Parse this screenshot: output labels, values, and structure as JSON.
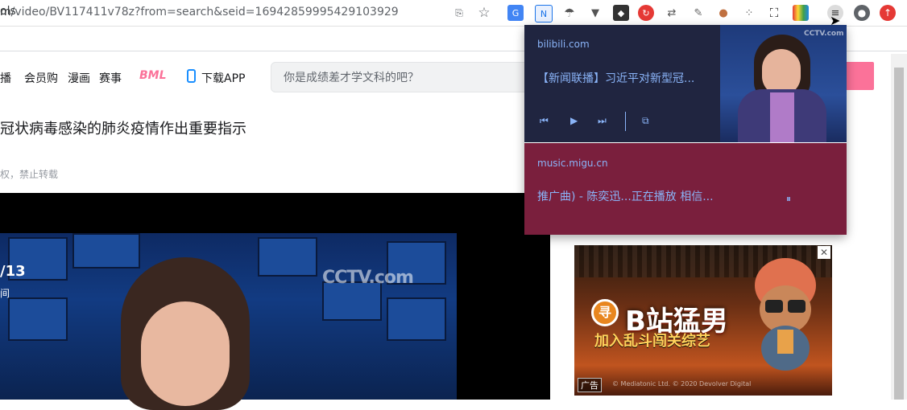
{
  "browser": {
    "url_host": "m",
    "url_rest": "/video/BV117411v78z?from=search&seid=16942859995429103929",
    "bookmarks_text": "ols"
  },
  "nav": {
    "items": [
      "播",
      "会员购",
      "漫画",
      "赛事"
    ],
    "bml": "BML",
    "download": "下载APP",
    "search_placeholder": "你是成绩差才学文科的吧？"
  },
  "video": {
    "title": "冠状病毒感染的肺炎疫情作出重要指示",
    "copyright": "权，禁止转载",
    "channel_badge": "/13",
    "channel_sub": "间",
    "watermark": "CCTV.com"
  },
  "media_popup": {
    "cards": [
      {
        "site": "bilibili.com",
        "track": "【新闻联播】习近平对新型冠...",
        "bg": "#202540"
      },
      {
        "site": "music.migu.cn",
        "track": "推广曲) - 陈奕迅...正在播放 相信...",
        "bg": "#7a1f3d"
      }
    ],
    "controls": {
      "prev": "⏮",
      "play": "▶",
      "next": "⏭",
      "pip": "⧉",
      "pause": "⏸"
    },
    "thumb_watermark": "CCTV.com"
  },
  "ad": {
    "title": "B站猛男",
    "subtitle": "加入乱斗闯关综艺",
    "tag": "广告",
    "small_print": "© Mediatonic Ltd. © 2020 Devolver Digital",
    "close": "✕"
  },
  "colors": {
    "accent": "#fb7299",
    "popup_text": "#8ab4f8"
  }
}
